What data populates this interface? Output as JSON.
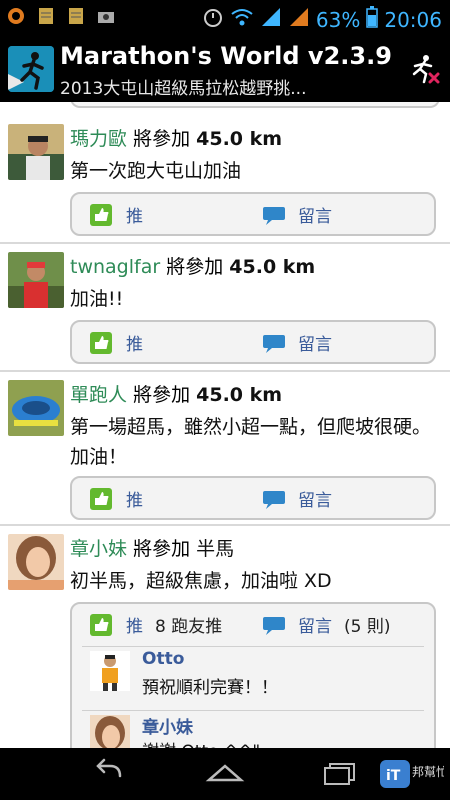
{
  "status_bar": {
    "battery": "63%",
    "time": "20:06"
  },
  "app": {
    "title": "Marathon's World v2.3.9",
    "subtitle": "2013大屯山超級馬拉松越野挑..."
  },
  "posts": [
    {
      "user": "瑪力歐",
      "verb": "將參加",
      "distance": "45.0 km",
      "message": "第一次跑大屯山加油",
      "like_label": "推",
      "comment_label": "留言"
    },
    {
      "user": "twnaglfar",
      "verb": "將參加",
      "distance": "45.0 km",
      "message": "加油!!",
      "like_label": "推",
      "comment_label": "留言"
    },
    {
      "user": "單跑人",
      "verb": "將參加",
      "distance": "45.0 km",
      "message": "第一場超馬，雖然小超一點，但爬坡很硬。加油！",
      "like_label": "推",
      "comment_label": "留言"
    },
    {
      "user": "章小妹",
      "verb": "將參加",
      "distance": "半馬",
      "message": "初半馬，超級焦慮，加油啦 XD",
      "like_label": "推",
      "like_count": "8 跑友推",
      "comment_label": "留言",
      "comment_count": "(5 則)",
      "comments": [
        {
          "name": "Otto",
          "text": "預祝順利完賽！！"
        },
        {
          "name": "章小妹",
          "text": "謝謝 Otto ^^\""
        }
      ]
    }
  ],
  "watermark": {
    "text": "邦幫忙"
  },
  "colors": {
    "username": "#2e8b57",
    "action": "#3a5b9a",
    "like": "#63b92e"
  }
}
